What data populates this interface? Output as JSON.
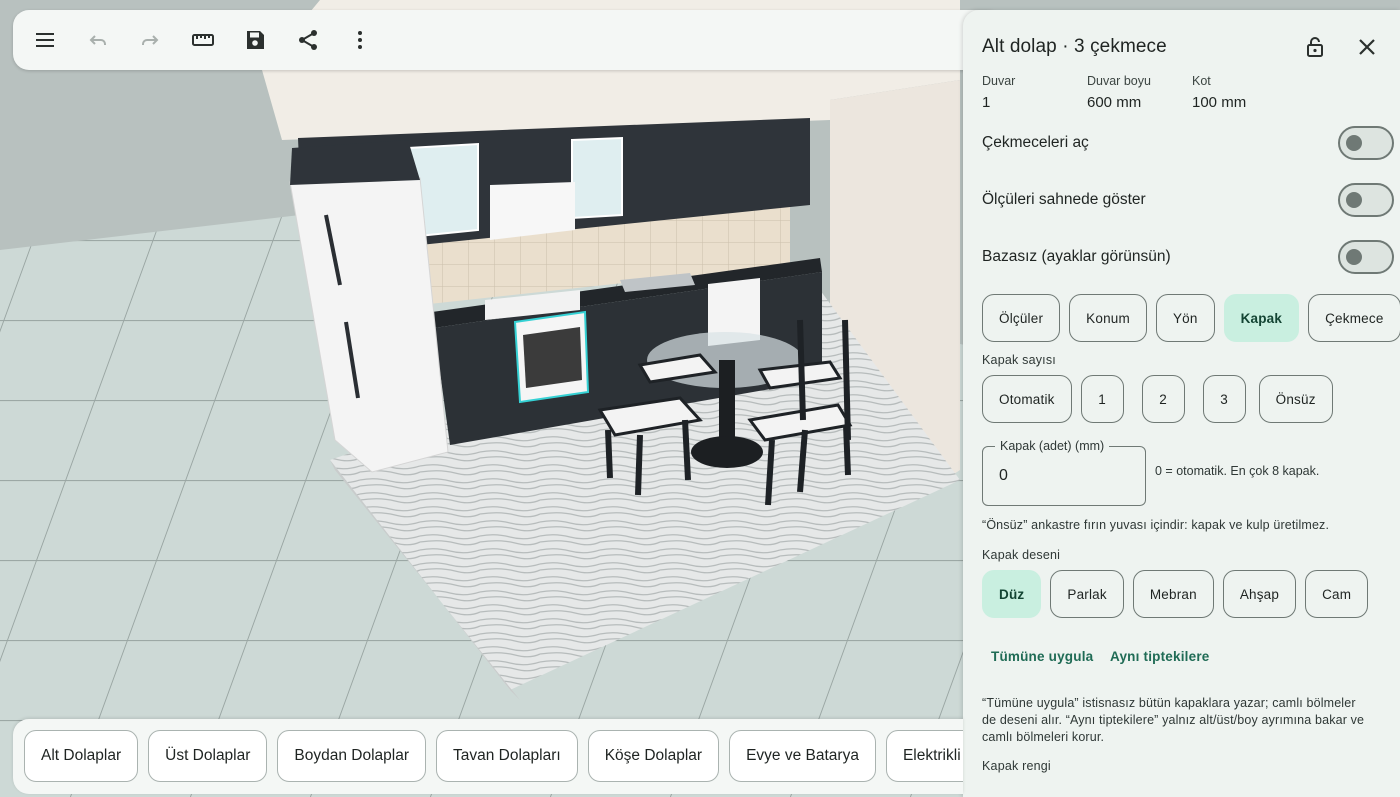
{
  "toolbar": {
    "buttons": [
      {
        "name": "menu-icon",
        "enabled": true
      },
      {
        "name": "undo-icon",
        "enabled": false
      },
      {
        "name": "redo-icon",
        "enabled": false
      },
      {
        "name": "ruler-icon",
        "enabled": true
      },
      {
        "name": "save-icon",
        "enabled": true
      },
      {
        "name": "share-icon",
        "enabled": true
      },
      {
        "name": "more-vert-icon",
        "enabled": true
      }
    ]
  },
  "panel": {
    "title": "Alt dolap · 3 çekmece",
    "lock_icon": "lock-open-icon",
    "close_icon": "close-icon",
    "info": [
      {
        "label": "Duvar",
        "value": "1"
      },
      {
        "label": "Duvar boyu",
        "value": "600 mm"
      },
      {
        "label": "Kot",
        "value": "100 mm"
      }
    ],
    "toggles": [
      {
        "label": "Çekmeceleri aç",
        "on": false
      },
      {
        "label": "Ölçüleri sahnede göster",
        "on": false
      },
      {
        "label": "Bazasız (ayaklar görünsün)",
        "on": false
      }
    ],
    "tabs": [
      "Ölçüler",
      "Konum",
      "Yön",
      "Kapak",
      "Çekmece"
    ],
    "selected_tab": "Kapak",
    "kapak_sayisi": {
      "label": "Kapak sayısı",
      "options": [
        "Otomatik",
        "1",
        "2",
        "3",
        "Önsüz"
      ]
    },
    "kapak_adet": {
      "label": "Kapak (adet) (mm)",
      "value": "0",
      "help": "0 = otomatik. En çok 8 kapak."
    },
    "onsuz_note": "“Önsüz” ankastre fırın yuvası içindir: kapak ve kulp üretilmez.",
    "kapak_deseni": {
      "label": "Kapak deseni",
      "options": [
        "Düz",
        "Parlak",
        "Mebran",
        "Ahşap",
        "Cam"
      ],
      "selected": "Düz"
    },
    "apply_all": "Tümüne uygula",
    "apply_same": "Aynı tiptekilere",
    "apply_note_1": "“Tümüne uygula” istisnasız bütün kapaklara yazar; camlı bölmeler",
    "apply_note_2": "de deseni alır. “Aynı tiptekilere” yalnız alt/üst/boy ayrımına bakar ve",
    "apply_note_3": "camlı bölmeleri korur.",
    "kapak_rengi": "Kapak rengi"
  },
  "categories": [
    "Alt Dolaplar",
    "Üst Dolaplar",
    "Boydan Dolaplar",
    "Tavan Dolapları",
    "Köşe Dolaplar",
    "Evye ve Batarya",
    "Elektrikli"
  ]
}
